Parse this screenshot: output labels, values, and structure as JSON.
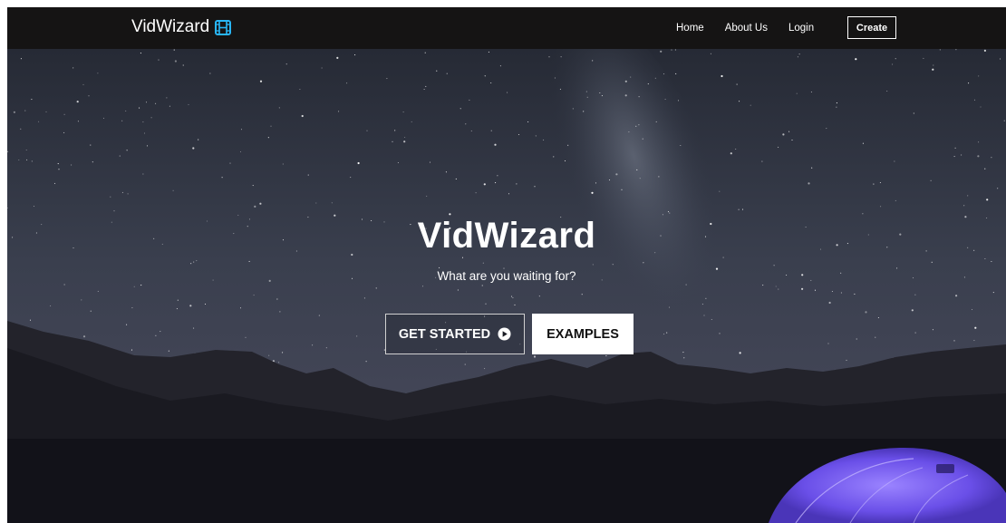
{
  "navbar": {
    "brand": "VidWizard",
    "brand_icon": "film-icon",
    "links": [
      "Home",
      "About Us",
      "Login"
    ],
    "create_label": "Create"
  },
  "hero": {
    "title": "VidWizard",
    "subtitle": "What are you waiting for?",
    "get_started_label": "GET STARTED",
    "get_started_icon": "play-circle-icon",
    "examples_label": "EXAMPLES"
  },
  "colors": {
    "navbar_bg": "#151414",
    "brand_icon": "#29b6f6",
    "tent": "#7b5cff"
  }
}
